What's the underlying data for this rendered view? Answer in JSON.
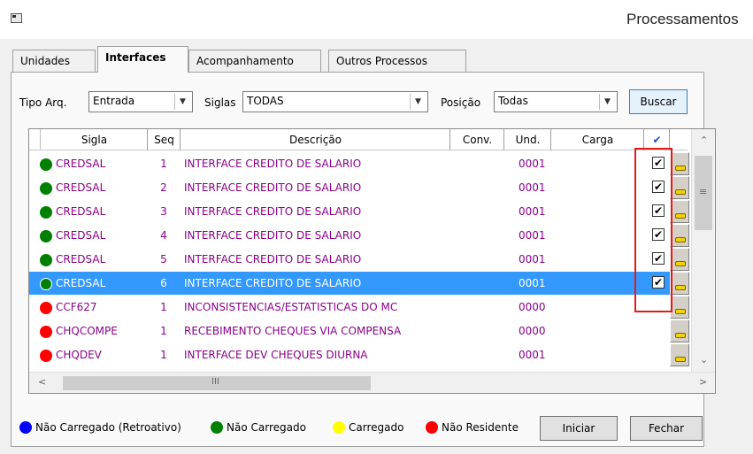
{
  "window": {
    "title": "Processamentos"
  },
  "tabs": [
    {
      "label": "Unidades",
      "active": false
    },
    {
      "label": "Interfaces",
      "active": true
    },
    {
      "label": "Acompanhamento",
      "active": false
    },
    {
      "label": "Outros Processos",
      "active": false
    }
  ],
  "filters": {
    "tipo_arq_label": "Tipo Arq.",
    "tipo_arq_value": "Entrada",
    "siglas_label": "Siglas",
    "siglas_value": "TODAS",
    "posicao_label": "Posição",
    "posicao_value": "Todas",
    "buscar_label": "Buscar"
  },
  "grid": {
    "columns": [
      "Sigla",
      "Seq",
      "Descrição",
      "Conv.",
      "Und.",
      "Carga",
      "✔"
    ],
    "rows": [
      {
        "status_color": "#008000",
        "sigla": "CREDSAL",
        "seq": "1",
        "descricao": "INTERFACE CREDITO DE SALARIO",
        "conv": "",
        "und": "0001",
        "carga": "",
        "checked": "✔",
        "selected": false
      },
      {
        "status_color": "#008000",
        "sigla": "CREDSAL",
        "seq": "2",
        "descricao": "INTERFACE CREDITO DE SALARIO",
        "conv": "",
        "und": "0001",
        "carga": "",
        "checked": "✔",
        "selected": false
      },
      {
        "status_color": "#008000",
        "sigla": "CREDSAL",
        "seq": "3",
        "descricao": "INTERFACE CREDITO DE SALARIO",
        "conv": "",
        "und": "0001",
        "carga": "",
        "checked": "✔",
        "selected": false
      },
      {
        "status_color": "#008000",
        "sigla": "CREDSAL",
        "seq": "4",
        "descricao": "INTERFACE CREDITO DE SALARIO",
        "conv": "",
        "und": "0001",
        "carga": "",
        "checked": "✔",
        "selected": false
      },
      {
        "status_color": "#008000",
        "sigla": "CREDSAL",
        "seq": "5",
        "descricao": "INTERFACE CREDITO DE SALARIO",
        "conv": "",
        "und": "0001",
        "carga": "",
        "checked": "✔",
        "selected": false
      },
      {
        "status_color": "#008000",
        "sigla": "CREDSAL",
        "seq": "6",
        "descricao": "INTERFACE CREDITO DE SALARIO",
        "conv": "",
        "und": "0001",
        "carga": "",
        "checked": "✔",
        "selected": true
      },
      {
        "status_color": "#ff0000",
        "sigla": "CCF627",
        "seq": "1",
        "descricao": "INCONSISTENCIAS/ESTATISTICAS DO MC",
        "conv": "",
        "und": "0000",
        "carga": "",
        "checked": "",
        "selected": false
      },
      {
        "status_color": "#ff0000",
        "sigla": "CHQCOMPE",
        "seq": "1",
        "descricao": "RECEBIMENTO CHEQUES VIA COMPENSA",
        "conv": "",
        "und": "0000",
        "carga": "",
        "checked": "",
        "selected": false
      },
      {
        "status_color": "#ff0000",
        "sigla": "CHQDEV",
        "seq": "1",
        "descricao": "INTERFACE DEV CHEQUES DIURNA",
        "conv": "",
        "und": "0001",
        "carga": "",
        "checked": "",
        "selected": false
      }
    ]
  },
  "scrollbar": {
    "h_mid_glyph": "III",
    "v_mid_glyph": "≡"
  },
  "legend": [
    {
      "color": "#0000ff",
      "label": "Não Carregado (Retroativo)"
    },
    {
      "color": "#008000",
      "label": "Não Carregado"
    },
    {
      "color": "#ffff00",
      "label": "Carregado"
    },
    {
      "color": "#ff0000",
      "label": "Não Residente"
    }
  ],
  "actions": {
    "iniciar_label": "Iniciar",
    "fechar_label": "Fechar"
  }
}
